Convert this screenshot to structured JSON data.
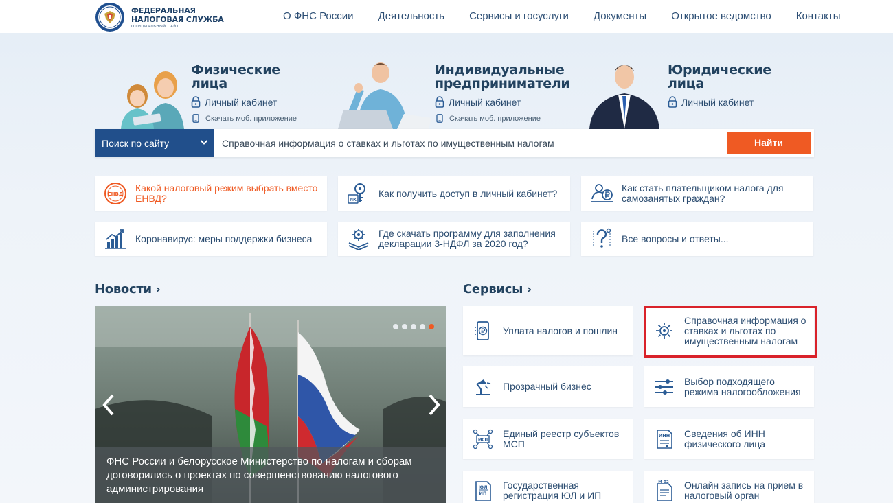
{
  "header": {
    "logo": {
      "line1": "ФЕДЕРАЛЬНАЯ",
      "line2": "НАЛОГОВАЯ СЛУЖБА",
      "line3": "ОФИЦИАЛЬНЫЙ САЙТ"
    },
    "nav": [
      "О ФНС России",
      "Деятельность",
      "Сервисы и госуслуги",
      "Документы",
      "Открытое ведомство",
      "Контакты"
    ]
  },
  "hero": [
    {
      "title_1": "Физические",
      "title_2": "лица",
      "link": "Личный кабинет",
      "sub": "Скачать моб. приложение"
    },
    {
      "title_1": "Индивидуальные",
      "title_2": "предприниматели",
      "link": "Личный кабинет",
      "sub": "Скачать моб. приложение"
    },
    {
      "title_1": "Юридические",
      "title_2": "лица",
      "link": "Личный кабинет"
    }
  ],
  "search": {
    "select_label": "Поиск по сайту",
    "placeholder": "Справочная информация о ставках и льготах по имущественным налогам",
    "button": "Найти"
  },
  "quick_links": [
    {
      "line1": "Какой налоговый режим выбрать вместо",
      "line2": "ЕНВД?",
      "icon": "envd-icon",
      "badge": "ЕНВД"
    },
    {
      "line1": "Как получить доступ в личный кабинет?",
      "line2": "",
      "icon": "key-lk-icon",
      "badge": "ЛК"
    },
    {
      "line1": "Как стать плательщиком налога для",
      "line2": "самозанятых граждан?",
      "icon": "self-employed-icon"
    },
    {
      "line1": "Коронавирус: меры поддержки бизнеса",
      "line2": "",
      "icon": "growth-chart-icon"
    },
    {
      "line1": "Где скачать программу для заполнения",
      "line2": "декларации 3-НДФЛ за 2020 год?",
      "icon": "download-program-icon"
    },
    {
      "line1": "Все вопросы и ответы...",
      "line2": "",
      "icon": "question-icon"
    }
  ],
  "news": {
    "title": "Новости",
    "caption": "ФНС России и белорусское Министерство по налогам и сборам договорились о проектах по совершенствованию налогового администрирования",
    "dots_total": 5,
    "active_dot": 5
  },
  "services": {
    "title": "Сервисы",
    "items": [
      {
        "line1": "Уплата налогов и пошлин",
        "line2": "",
        "line3": "",
        "icon": "payment-phone-icon"
      },
      {
        "line1": "Справочная информация о",
        "line2": "ставках и льготах по",
        "line3": "имущественным налогам",
        "icon": "reference-info-icon"
      },
      {
        "line1": "Прозрачный бизнес",
        "line2": "",
        "line3": "",
        "icon": "lamp-icon"
      },
      {
        "line1": "Выбор подходящего",
        "line2": "режима налогообложения",
        "line3": "",
        "icon": "sliders-icon"
      },
      {
        "line1": "Единый реестр субъектов",
        "line2": "МСП",
        "line3": "",
        "icon": "msp-registry-icon",
        "badge": "МСП"
      },
      {
        "line1": "Сведения об ИНН",
        "line2": "физического лица",
        "line3": "",
        "icon": "inn-document-icon",
        "badge": "ИНН"
      },
      {
        "line1": "Государственная",
        "line2": "регистрация ЮЛ и ИП",
        "line3": "",
        "icon": "registration-icon",
        "badge1": "ЮЛ",
        "badge2": "ИП"
      },
      {
        "line1": "Онлайн запись на прием в",
        "line2": "налоговый орган",
        "line3": "",
        "icon": "appointment-icon",
        "badge": "М-02"
      }
    ]
  },
  "colors": {
    "primary_blue": "#214f8b",
    "accent_orange": "#ef5a23",
    "text_blue": "#2b4c70",
    "highlight_red": "#d9222a"
  }
}
